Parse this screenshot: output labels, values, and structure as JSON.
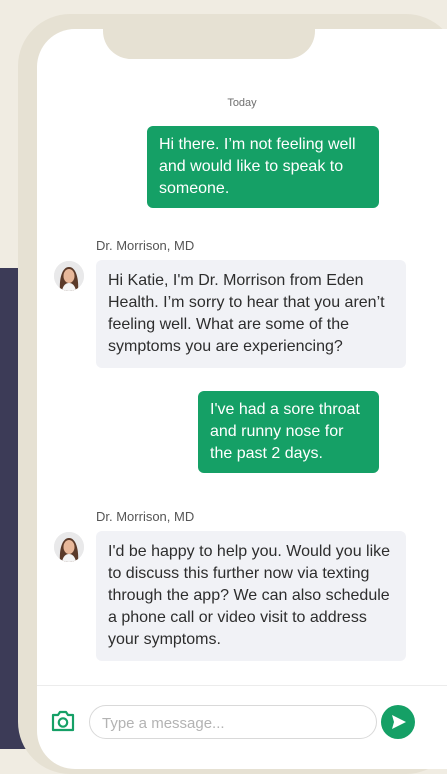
{
  "chat": {
    "day_label": "Today",
    "messages": [
      {
        "from": "user",
        "text": "Hi there. I’m not feeling well and would like to speak to someone."
      },
      {
        "from": "doctor",
        "sender": "Dr. Morrison, MD",
        "text": "Hi Katie, I'm Dr. Morrison from Eden Health. I’m sorry to hear that you aren’t feeling well. What are some of the symptoms you are experiencing?"
      },
      {
        "from": "user",
        "text": "I've had a sore throat and runny nose for the past 2 days."
      },
      {
        "from": "doctor",
        "sender": "Dr. Morrison, MD",
        "text": "I'd be happy to help you. Would you like to discuss this further now via texting through the app? We can also schedule a phone call or video visit to address your symptoms."
      }
    ]
  },
  "composer": {
    "placeholder": "Type a message...",
    "camera_icon": "camera-icon",
    "send_icon": "send-icon"
  },
  "colors": {
    "accent": "#15a066",
    "bubble_incoming": "#f1f2f6",
    "frame": "#e6e1d3",
    "dark_background": "#3c3b57"
  }
}
